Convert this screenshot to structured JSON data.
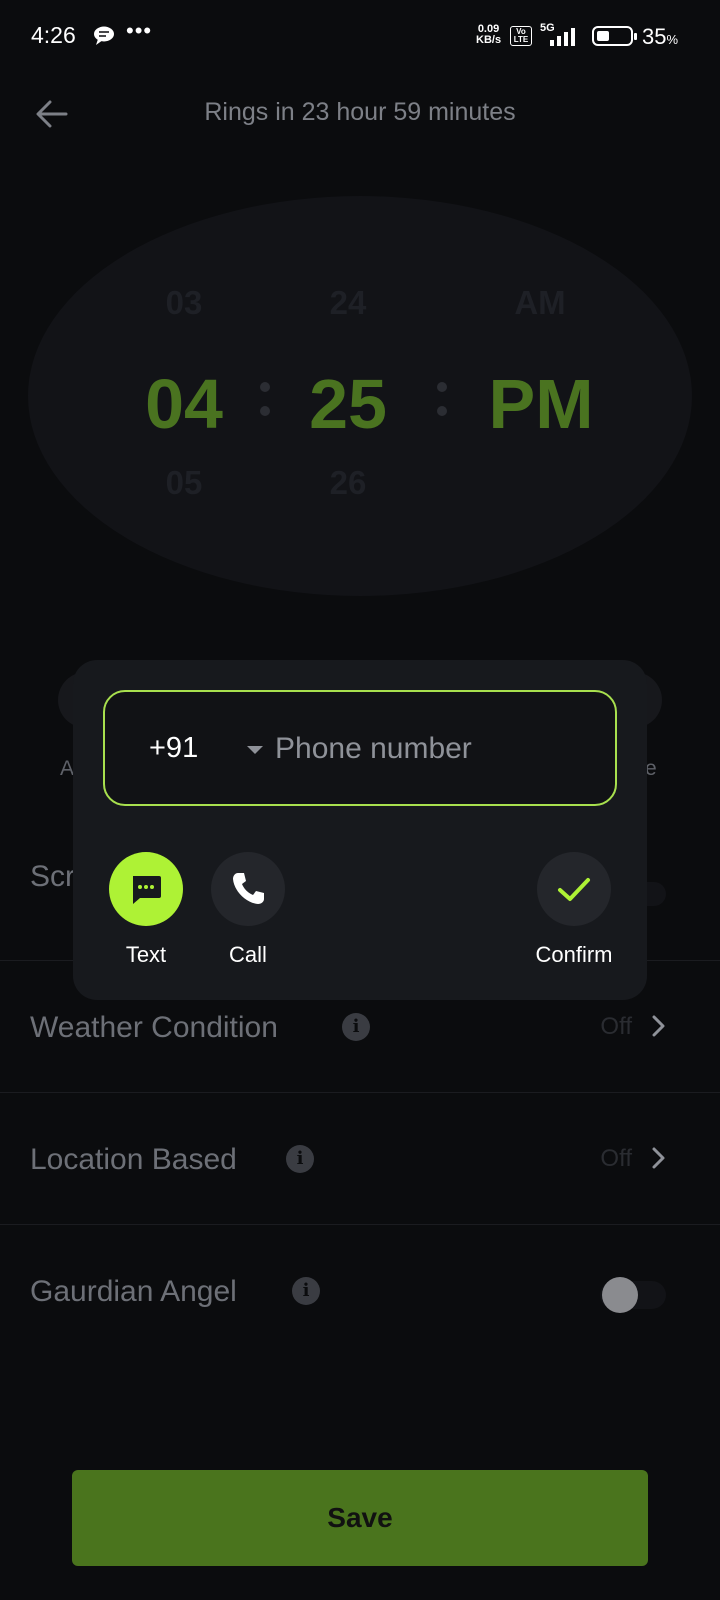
{
  "status_bar": {
    "time": "4:26",
    "dots": "•••",
    "net_speed_value": "0.09",
    "net_speed_unit": "KB/s",
    "volte_top": "Vo",
    "volte_bottom": "LTE",
    "network": "5G",
    "battery_percent": "35",
    "battery_percent_sign": "%"
  },
  "header": {
    "title": "Rings in 23 hour 59 minutes"
  },
  "time_picker": {
    "hour_prev": "03",
    "hour": "04",
    "hour_next": "05",
    "minute_prev": "24",
    "minute": "25",
    "minute_next": "26",
    "period_prev": "AM",
    "period": "PM"
  },
  "background_fragments": {
    "left_letter": "A",
    "right_letter": "e",
    "row_partial": "Scr"
  },
  "settings": {
    "weather": {
      "label": "Weather Condition",
      "value": "Off"
    },
    "location": {
      "label": "Location Based",
      "value": "Off"
    },
    "guardian": {
      "label": "Gaurdian Angel",
      "enabled": false
    }
  },
  "popup": {
    "country_code": "+91",
    "phone_placeholder": "Phone number",
    "phone_value": "",
    "text_label": "Text",
    "call_label": "Call",
    "confirm_label": "Confirm"
  },
  "save_label": "Save",
  "colors": {
    "accent": "#aef235",
    "save_bg": "#4a741d",
    "picker_selected": "#4a7320",
    "background": "#0b0c0e"
  }
}
